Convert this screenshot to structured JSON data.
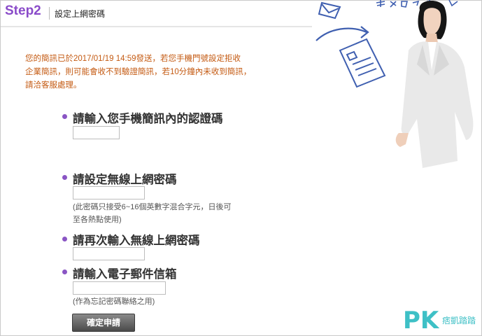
{
  "header": {
    "step": "Step2",
    "title": "設定上網密碼"
  },
  "notice": {
    "line1": "您的簡訊已於2017/01/19 14:59發送，若您手機門號設定拒收",
    "line2": "企業簡訊，則可能會收不到驗證簡訊，若10分鐘內未收到簡訊，",
    "line3": "請洽客服處理。"
  },
  "form": {
    "verify_label": "請輸入您手機簡訊內的認證碼",
    "password_label": "請設定無線上網密碼",
    "password_hint_line1": "(此密碼只接受6~16個英數字混合字元，日後可",
    "password_hint_line2": "至各熱點使用)",
    "confirm_label": "請再次輸入無線上網密碼",
    "email_label": "請輸入電子郵件信箱",
    "email_hint": "(作為忘記密碼聯絡之用)",
    "submit_label": "確定申請"
  },
  "watermark": {
    "brand": "PK",
    "text": "痞凱踏踏"
  },
  "colors": {
    "accent": "#8a4bc9",
    "notice": "#c45a12",
    "bullet": "#8a55c4"
  }
}
